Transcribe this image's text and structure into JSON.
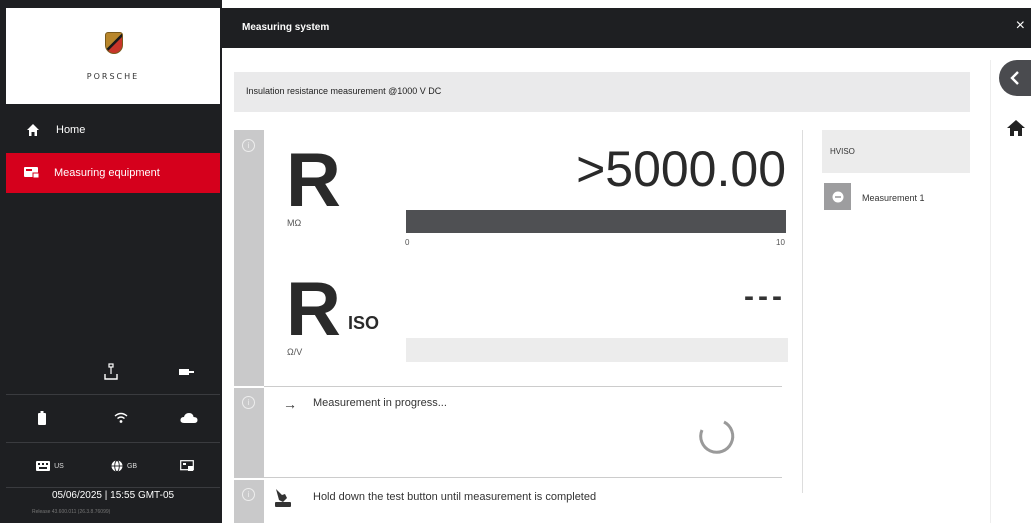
{
  "brand": {
    "wordmark": "PORSCHE"
  },
  "sidebar": {
    "nav": [
      {
        "label": "Home",
        "icon": "home-icon"
      },
      {
        "label": "Measuring equipment",
        "icon": "measuring-equipment-icon",
        "active": true
      }
    ],
    "status": {
      "keyboard_label": "US",
      "language_label": "GB",
      "datetime": "05/06/2025  |  15:55 GMT-05",
      "version": "Release 43.600.011 (26.3.8.76099)"
    },
    "accent_color": "#d5001c"
  },
  "topbar": {
    "title": "Measuring system",
    "close_label": "×"
  },
  "header": {
    "text": "Insulation resistance measurement @1000 V DC"
  },
  "measurement": {
    "r": {
      "symbol": "R",
      "unit": "MΩ",
      "value": ">5000.00",
      "scale_min": "0",
      "scale_max": "10",
      "bar_fraction": 1.0
    },
    "riso": {
      "symbol": "R",
      "subscript": "ISO",
      "unit": "Ω/V",
      "value": "---",
      "bar_fraction": 0.0
    }
  },
  "status_messages": {
    "progress": "Measurement in progress...",
    "instruction": "Hold down the test button until measurement is completed"
  },
  "right_panel": {
    "group": "HVISO",
    "items": [
      {
        "label": "Measurement 1"
      }
    ]
  }
}
